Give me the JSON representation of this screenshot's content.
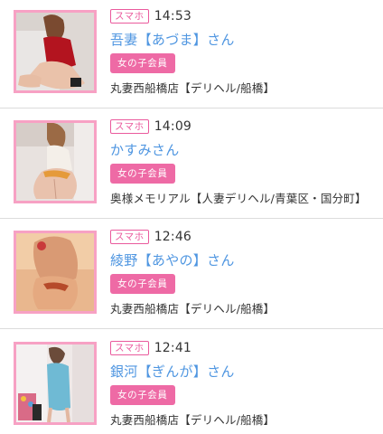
{
  "entries": [
    {
      "badge": "スマホ",
      "time": "14:53",
      "name": "吾妻【あづま】さん",
      "member": "女の子会員",
      "shop": "丸妻西船橋店【デリヘル/船橋】"
    },
    {
      "badge": "スマホ",
      "time": "14:09",
      "name": "かすみさん",
      "member": "女の子会員",
      "shop": "奥様メモリアル【人妻デリヘル/青葉区・国分町】"
    },
    {
      "badge": "スマホ",
      "time": "12:46",
      "name": "綾野【あやの】さん",
      "member": "女の子会員",
      "shop": "丸妻西船橋店【デリヘル/船橋】"
    },
    {
      "badge": "スマホ",
      "time": "12:41",
      "name": "銀河【ぎんが】さん",
      "member": "女の子会員",
      "shop": "丸妻西船橋店【デリヘル/船橋】"
    }
  ]
}
